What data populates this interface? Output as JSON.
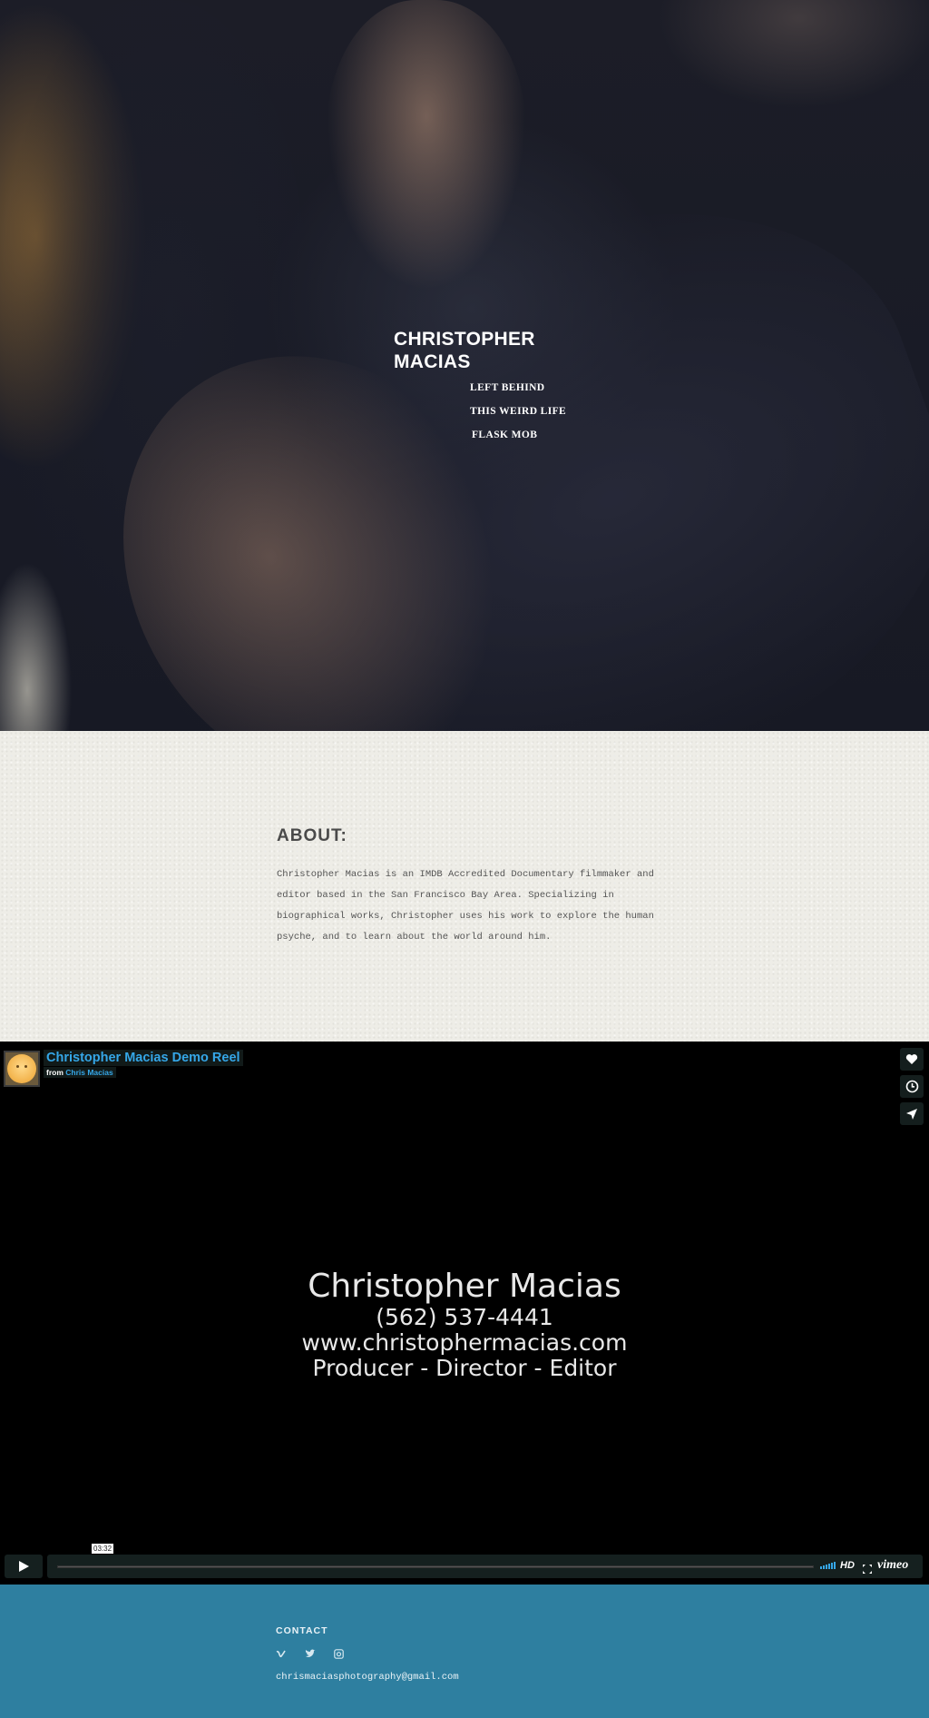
{
  "hero": {
    "brand_line1": "CHRISTOPHER",
    "brand_line2": "MACIAS",
    "nav": [
      "LEFT BEHIND",
      "THIS WEIRD LIFE",
      "FLASK MOB"
    ]
  },
  "about": {
    "heading": "ABOUT:",
    "body": "Christopher Macias is an IMDB Accredited Documentary filmmaker and editor based in the San Francisco Bay Area. Specializing in biographical works, Christopher uses his work to explore the human psyche, and to learn about the world around him."
  },
  "video": {
    "title": "Christopher Macias Demo Reel",
    "from_label": "from",
    "author": "Chris Macias",
    "card_line1": "Christopher Macias",
    "card_line2": "(562) 537-4441",
    "card_line3": "www.christophermacias.com",
    "card_line4": "Producer - Director - Editor",
    "duration": "03:32",
    "hd_label": "HD",
    "logo": "vimeo",
    "side_buttons": [
      "heart-icon",
      "clock-icon",
      "send-icon"
    ],
    "accent_color": "#35a7e8"
  },
  "footer": {
    "heading": "CONTACT",
    "socials": [
      "vimeo-icon",
      "twitter-icon",
      "instagram-icon"
    ],
    "email": "chrismaciasphotography@gmail.com",
    "background_color": "#2e7fa0"
  }
}
